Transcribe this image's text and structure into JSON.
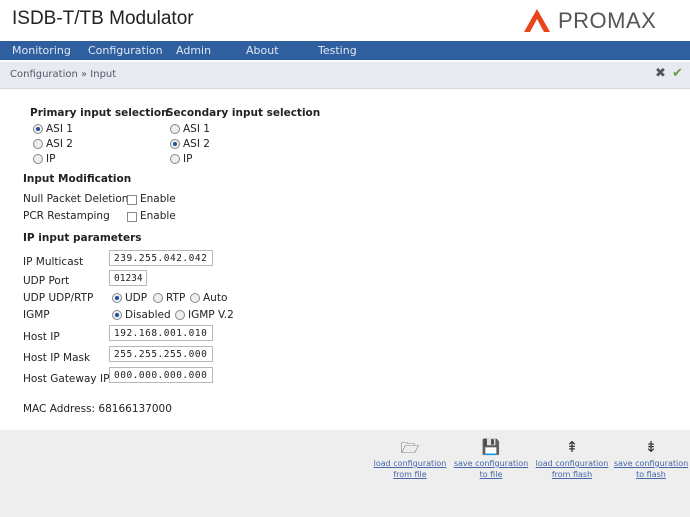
{
  "app": {
    "title": "ISDB-T/TB Modulator",
    "logo_text": "PROMAX"
  },
  "menu": [
    "Monitoring",
    "Configuration",
    "Admin",
    "About",
    "Testing"
  ],
  "breadcrumb": "Configuration » Input",
  "breadcrumb_icons": {
    "close": "✖",
    "apply": "✔"
  },
  "primary": {
    "title": "Primary input selection",
    "options": [
      "ASI 1",
      "ASI 2",
      "IP"
    ],
    "selected": "ASI 1"
  },
  "secondary": {
    "title": "Secondary input selection",
    "options": [
      "ASI 1",
      "ASI 2",
      "IP"
    ],
    "selected": "ASI 2"
  },
  "modification": {
    "title": "Input Modification",
    "null_packet_label": "Null Packet Deletion",
    "pcr_label": "PCR Restamping",
    "enable_label": "Enable"
  },
  "ip": {
    "title": "IP input parameters",
    "multicast_label": "IP Multicast",
    "multicast_value": "239.255.042.042",
    "udp_port_label": "UDP Port",
    "udp_port_value": "01234",
    "udp_rtp_label": "UDP UDP/RTP",
    "udp_options": [
      "UDP",
      "RTP",
      "Auto"
    ],
    "udp_selected": "UDP",
    "igmp_label": "IGMP",
    "igmp_options": [
      "Disabled",
      "IGMP V.2"
    ],
    "igmp_selected": "Disabled",
    "host_ip_label": "Host IP",
    "host_ip_value": "192.168.001.010",
    "mask_label": "Host IP Mask",
    "mask_value": "255.255.255.000",
    "gateway_label": "Host Gateway IP",
    "gateway_value": "000.000.000.000"
  },
  "mac": "MAC Address: 68166137000",
  "actions": [
    {
      "icon": "🗁",
      "line1": "load configuration",
      "line2": "from file"
    },
    {
      "icon": "💾",
      "line1": "save configuration",
      "line2": "to file"
    },
    {
      "icon": "⇞",
      "line1": "load configuration",
      "line2": "from flash"
    },
    {
      "icon": "⇟",
      "line1": "save configuration",
      "line2": "to flash"
    }
  ]
}
